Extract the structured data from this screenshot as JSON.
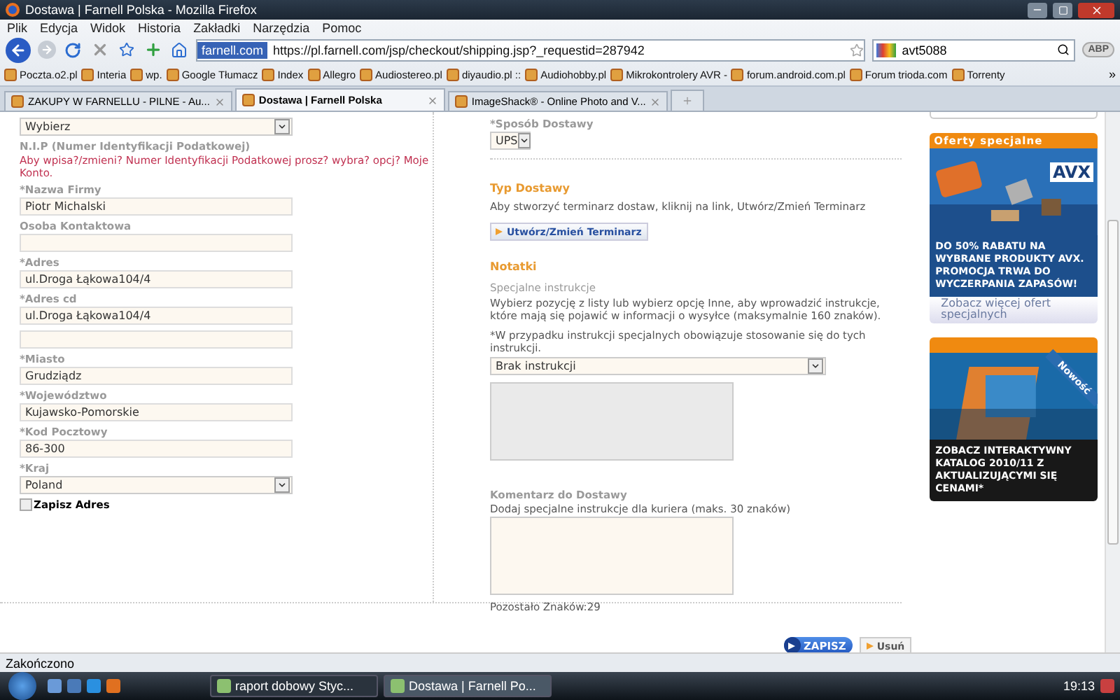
{
  "window": {
    "title": "Dostawa | Farnell Polska - Mozilla Firefox"
  },
  "menu": [
    "Plik",
    "Edycja",
    "Widok",
    "Historia",
    "Zakładki",
    "Narzędzia",
    "Pomoc"
  ],
  "address": {
    "site": "farnell.com",
    "url": "https://pl.farnell.com/jsp/checkout/shipping.jsp?_requestid=287942"
  },
  "search": {
    "value": "avt5088"
  },
  "addon_button": "ABP",
  "bookmarks": [
    "Poczta.o2.pl",
    "Interia",
    "wp.",
    "Google Tłumacz",
    "Index",
    "Allegro",
    "Audiostereo.pl",
    "diyaudio.pl ::",
    "Audiohobby.pl",
    "Mikrokontrolery AVR -",
    "forum.android.com.pl",
    "Forum trioda.com",
    "Torrenty"
  ],
  "bookmarks_more": "»",
  "tabs": [
    {
      "label": "ZAKUPY W FARNELLU - PILNE - Au...",
      "selected": false
    },
    {
      "label": "Dostawa | Farnell Polska",
      "selected": true
    },
    {
      "label": "ImageShack® - Online Photo and V...",
      "selected": false
    }
  ],
  "address_form": {
    "top_select": "Wybierz",
    "nip_label": "N.I.P (Numer Identyfikacji Podatkowej)",
    "nip_note": "Aby wpisa?/zmieni? Numer Identyfikacji Podatkowej prosz? wybra? opcj? Moje Konto.",
    "fields": [
      {
        "label": "*Nazwa Firmy",
        "value": "Piotr Michalski",
        "extra_line": false
      },
      {
        "label": "Osoba Kontaktowa",
        "extra_line": false
      },
      {
        "label": "*Adres",
        "value": "ul.Droga Łąkowa104/4",
        "extra_line": false
      },
      {
        "label": "*Adres cd",
        "value": "ul.Droga Łąkowa104/4",
        "extra_line": true
      },
      {
        "label": "*Miasto",
        "value": "Grudziądz",
        "extra_line": false
      },
      {
        "label": "*Województwo",
        "value": "Kujawsko-Pomorskie",
        "extra_line": false
      },
      {
        "label": "*Kod Pocztowy",
        "value": "86-300",
        "extra_line": false
      }
    ],
    "country": {
      "label": "*Kraj",
      "value": "Poland"
    },
    "save_address": {
      "label": "Zapisz Adres",
      "checked": false
    }
  },
  "shipping": {
    "method": {
      "label": "*Sposób Dostawy",
      "value": "UPS"
    },
    "type_heading": "Typ Dostawy",
    "type_text": "Aby stworzyć terminarz dostaw, kliknij na link, Utwórz/Zmień Terminarz",
    "schedule_button": "Utwórz/Zmień Terminarz",
    "notes_heading": "Notatki",
    "instructions_label": "Specjalne instrukcje",
    "instructions_text": "Wybierz pozycję z listy lub wybierz opcję Inne, aby wprowadzić instrukcje, które mają się pojawić w informacji o wysyłce (maksymalnie 160 znaków).",
    "instructions_note": "*W przypadku instrukcji specjalnych obowiązuje stosowanie się do tych instrukcji.",
    "instructions_select": "Brak instrukcji",
    "instructions_box": {
      "disabled": true
    },
    "comment_label": "Komentarz do Dostawy",
    "comment_text": "Dodaj specjalne instrukcje dla kuriera (maks. 30 znaków)",
    "comment_box": {
      "disabled": false
    },
    "remaining": "Pozostało Znaków:29"
  },
  "promos": [
    {
      "header": "Oferty specjalne",
      "logo": "AVX",
      "text": "DO 50% RABATU NA WYBRANE PRODUKTY AVX. PROMOCJA TRWA DO WYCZERPANIA ZAPASÓW!",
      "link": "Zobacz więcej ofert specjalnych"
    },
    {
      "ribbon": "Nowość",
      "text": "ZOBACZ INTERAKTYWNY KATALOG 2010/11 Z AKTUALIZUJĄCYMI SIĘ CENAMI*"
    }
  ],
  "actions": {
    "save": "ZAPISZ",
    "remove": "Usuń"
  },
  "status_bar": "Zakończono",
  "taskbar": {
    "items": [
      {
        "label": "raport dobowy Styc...",
        "selected": false
      },
      {
        "label": "Dostawa | Farnell Po...",
        "selected": true
      }
    ],
    "clock": "19:13"
  }
}
